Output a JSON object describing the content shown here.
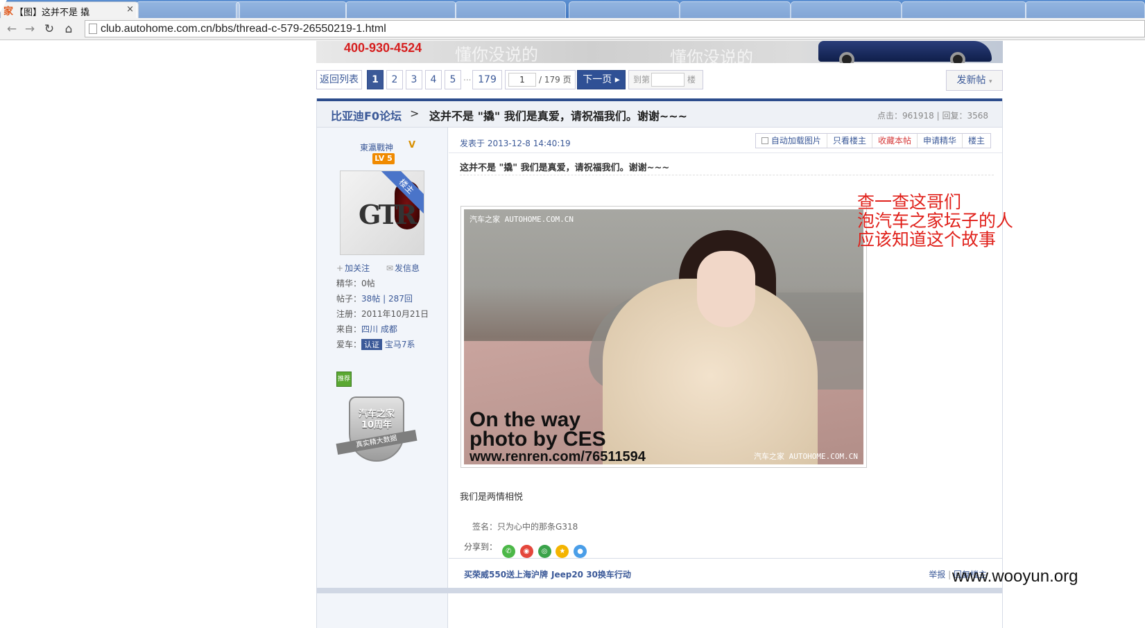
{
  "browser": {
    "active_tab_title": "【图】这并不是 撬",
    "tab_favicon": "家",
    "url": "club.autohome.com.cn/bbs/thread-c-579-26550219-1.html"
  },
  "banner": {
    "phone": "400-930-4524",
    "slogan": "懂你没说的"
  },
  "pager": {
    "back": "返回列表",
    "pages": [
      "1",
      "2",
      "3",
      "4",
      "5"
    ],
    "ellipsis": "...",
    "last": "179",
    "page_input": "1",
    "total": "/ 179 页",
    "next": "下一页",
    "goto_label": "到第",
    "goto_unit": "楼",
    "new_post": "发新帖"
  },
  "thread": {
    "forum": "比亚迪F0论坛",
    "sep": ">",
    "title": "这并不是 \"撬\" 我们是真爱，请祝福我们。谢谢~~~",
    "stats": "点击：961918 | 回复：3568"
  },
  "author": {
    "name": "東瀛戰神",
    "v": "V",
    "level": "LV 5",
    "ribbon": "楼主",
    "follow": "加关注",
    "message": "发信息",
    "essence_label": "精华：",
    "essence": "0帖",
    "posts_label": "帖子：",
    "posts": "38帖 | 287回",
    "reg_label": "注册：",
    "reg": "2011年10月21日",
    "from_label": "来自：",
    "from": "四川 成都",
    "car_label": "爱车：",
    "cert": "认证",
    "car": "宝马7系",
    "rec_badge": "推荐",
    "anniv_text": "汽车之家10周年",
    "anniv_band": "真实精大数据"
  },
  "post": {
    "time": "发表于 2013-12-8 14:40:19",
    "tools": [
      "自动加载图片",
      "只看楼主",
      "收藏本帖",
      "申请精华",
      "楼主"
    ],
    "subject": "这并不是 \"撬\" 我们是真爱，请祝福我们。谢谢~~~",
    "photo_watermark": "汽车之家 AUTOHOME.COM.CN",
    "photo_caption_1": "On the way",
    "photo_caption_2": "photo by CES",
    "photo_caption_3": "www.renren.com/76511594",
    "photo_watermark_2": "汽车之家 AUTOHOME.COM.CN",
    "text": "我们是两情相悦",
    "signature_label": "签名：",
    "signature": "只为心中的那条G318",
    "share_label": "分享到："
  },
  "annotation": [
    "查一查这哥们",
    "泡汽车之家坛子的人",
    "应该知道这个故事"
  ],
  "footer": {
    "link1": "买荣威550送上海沪牌",
    "link2": "Jeep20 30换车行动",
    "report": "举报",
    "divider": "|",
    "reply": "回复楼主"
  },
  "watermark": "www.wooyun.org",
  "colors": {
    "brand_blue": "#3b5998",
    "red": "#e0201a"
  }
}
